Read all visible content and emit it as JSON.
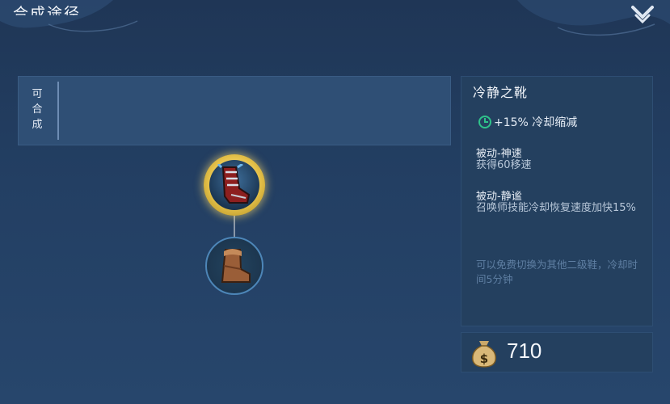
{
  "header": {
    "title": "合成途径"
  },
  "compose": {
    "label": "可合成"
  },
  "item": {
    "name": "冷静之靴",
    "stat": "+15% 冷却缩减",
    "passives": [
      {
        "title": "被动-神速",
        "desc": "获得60移速"
      },
      {
        "title": "被动-静谧",
        "desc": "召唤师技能冷却恢复速度加快15%"
      }
    ],
    "note": "可以免费切换为其他二级鞋，冷却时间5分钟",
    "price": "710"
  },
  "tree": {
    "top_item": "boots-of-tranquility-icon",
    "bottom_item": "basic-boots-icon"
  },
  "colors": {
    "gold": "#e6c24a",
    "accent_green": "#2fc28a"
  }
}
